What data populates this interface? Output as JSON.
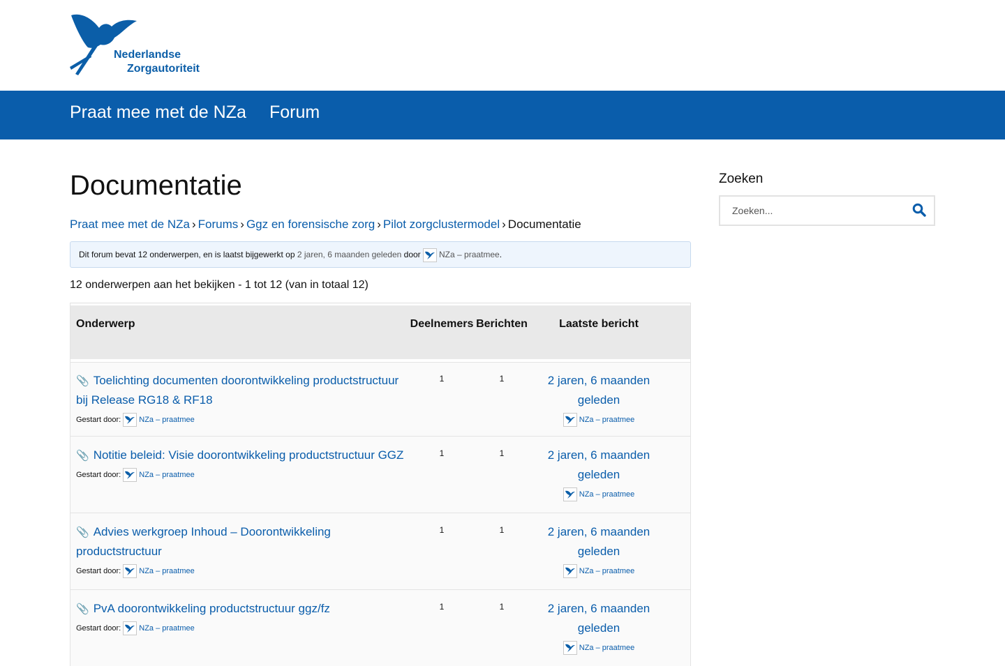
{
  "logo": {
    "line1": "Nederlandse",
    "line2": "Zorgautoriteit"
  },
  "nav": {
    "home": "Praat mee met de NZa",
    "forum": "Forum"
  },
  "page_title": "Documentatie",
  "breadcrumb": [
    {
      "label": "Praat mee met de NZa"
    },
    {
      "label": "Forums"
    },
    {
      "label": "Ggz en forensische zorg"
    },
    {
      "label": "Pilot zorgclustermodel"
    },
    {
      "label": "Documentatie"
    }
  ],
  "breadcrumb_sep": "›",
  "notice": {
    "prefix": "Dit forum bevat 12 onderwerpen, en is laatst bijgewerkt op",
    "freshness": "2 jaren, 6 maanden geleden",
    "by": "door",
    "author": "NZa – praatmee",
    "suffix": "."
  },
  "count_text": "12 onderwerpen aan het bekijken - 1 tot 12 (van in totaal 12)",
  "table": {
    "headers": {
      "topic": "Onderwerp",
      "voices": "Deelnemers",
      "posts": "Berichten",
      "freshness": "Laatste bericht"
    },
    "rows": [
      {
        "title": "Toelichting documenten doorontwikkeling productstructuur bij Release RG18 & RF18",
        "started_label": "Gestart door:",
        "author": "NZa – praatmee",
        "voices": "1",
        "posts": "1",
        "freshness": "2 jaren, 6 maanden geleden",
        "last_author": "NZa – praatmee"
      },
      {
        "title": "Notitie beleid: Visie doorontwikkeling productstructuur GGZ",
        "started_label": "Gestart door:",
        "author": "NZa – praatmee",
        "voices": "1",
        "posts": "1",
        "freshness": "2 jaren, 6 maanden geleden",
        "last_author": "NZa – praatmee"
      },
      {
        "title": "Advies werkgroep Inhoud – Doorontwikkeling productstructuur",
        "started_label": "Gestart door:",
        "author": "NZa – praatmee",
        "voices": "1",
        "posts": "1",
        "freshness": "2 jaren, 6 maanden geleden",
        "last_author": "NZa – praatmee"
      },
      {
        "title": "PvA doorontwikkeling productstructuur ggz/fz",
        "started_label": "Gestart door:",
        "author": "NZa – praatmee",
        "voices": "1",
        "posts": "1",
        "freshness": "2 jaren, 6 maanden geleden",
        "last_author": "NZa – praatmee"
      }
    ]
  },
  "sidebar": {
    "title": "Zoeken",
    "search_placeholder": "Zoeken..."
  },
  "icons": {
    "search": "search-icon",
    "attachment": "paperclip-icon",
    "logo": "nza-bird-logo"
  },
  "colors": {
    "brand": "#0a5dab",
    "header_bg": "#e9e9e9",
    "notice_bg": "#eef5fd"
  }
}
